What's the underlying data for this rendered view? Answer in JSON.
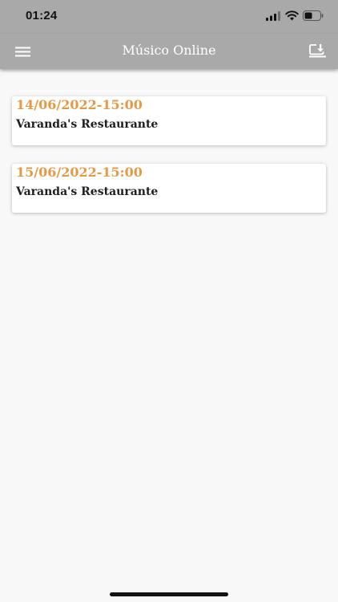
{
  "status_bar": {
    "time": "01:24",
    "icons": [
      "signal-icon",
      "wifi-icon",
      "battery-icon"
    ]
  },
  "nav": {
    "title": "Músico Online",
    "left_icon": "menu-icon",
    "right_icon": "download-icon"
  },
  "events": [
    {
      "date": "14/06/2022-15:00",
      "venue": "Varanda's Restaurante"
    },
    {
      "date": "15/06/2022-15:00",
      "venue": "Varanda's Restaurante"
    }
  ],
  "colors": {
    "bar_bg": "#a9a9a9",
    "page_bg": "#f8f8f8",
    "date_text": "#e39a46",
    "venue_text": "#1e1e1e",
    "title_text": "#ffffff"
  }
}
